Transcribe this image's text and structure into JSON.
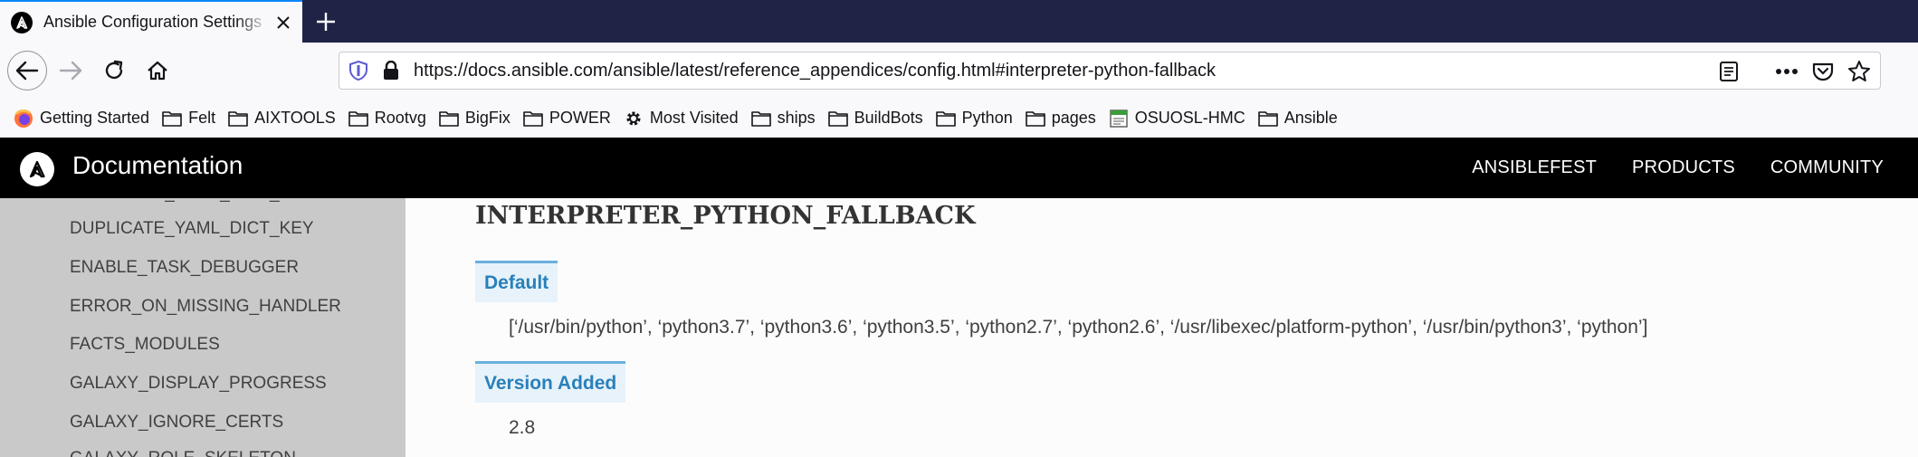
{
  "browser": {
    "tab_title": "Ansible Configuration Settings",
    "url": "https://docs.ansible.com/ansible/latest/reference_appendices/config.html#interpreter-python-fallback",
    "bookmarks": [
      {
        "label": "Getting Started",
        "icon": "firefox-icon"
      },
      {
        "label": "Felt",
        "icon": "folder-icon"
      },
      {
        "label": "AIXTOOLS",
        "icon": "folder-icon"
      },
      {
        "label": "Rootvg",
        "icon": "folder-icon"
      },
      {
        "label": "BigFix",
        "icon": "folder-icon"
      },
      {
        "label": "POWER",
        "icon": "folder-icon"
      },
      {
        "label": "Most Visited",
        "icon": "gear-icon"
      },
      {
        "label": "ships",
        "icon": "folder-icon"
      },
      {
        "label": "BuildBots",
        "icon": "folder-icon"
      },
      {
        "label": "Python",
        "icon": "folder-icon"
      },
      {
        "label": "pages",
        "icon": "folder-icon"
      },
      {
        "label": "OSUOSL-HMC",
        "icon": "page-icon"
      },
      {
        "label": "Ansible",
        "icon": "folder-icon"
      }
    ]
  },
  "site": {
    "title": "Documentation",
    "nav": [
      "ANSIBLEFEST",
      "PRODUCTS",
      "COMMUNITY"
    ]
  },
  "sidebar": {
    "items": [
      "DUPLICATE_YAML_DICT_KEY",
      "ENABLE_TASK_DEBUGGER",
      "ERROR_ON_MISSING_HANDLER",
      "FACTS_MODULES",
      "GALAXY_DISPLAY_PROGRESS",
      "GALAXY_IGNORE_CERTS",
      "GALAXY_ROLE_SKELETON"
    ]
  },
  "content": {
    "section_title": "INTERPRETER_PYTHON_FALLBACK",
    "default_label": "Default",
    "default_value": "[‘/usr/bin/python’, ‘python3.7’, ‘python3.6’, ‘python3.5’, ‘python2.7’, ‘python2.6’, ‘/usr/libexec/platform-python’, ‘/usr/bin/python3’, ‘python’]",
    "version_label": "Version Added",
    "version_value": "2.8"
  },
  "colors": {
    "tabstrip": "#1f2345",
    "tab_accent": "#0a84ff",
    "header": "#000000",
    "sidebar": "#c9c9c9",
    "label_bg": "#e7f2fa",
    "label_border": "#6ab0de",
    "label_text": "#2980b9"
  }
}
